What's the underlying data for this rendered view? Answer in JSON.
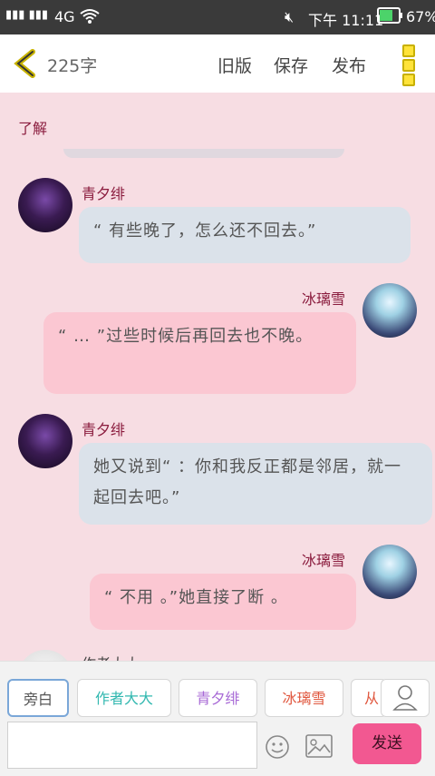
{
  "status": {
    "network": "4G",
    "time": "下午 11:11",
    "battery": "67%"
  },
  "header": {
    "word_count": "225字",
    "old_version": "旧版",
    "save": "保存",
    "publish": "发布"
  },
  "chat": {
    "partial_name": "了解",
    "messages": [
      {
        "name": "青夕绯",
        "text": "“ 有些晚了，怎么还不回去。”",
        "side": "left",
        "avatar": "dark"
      },
      {
        "name": "冰璃雪",
        "text": "“ … ”过些时候后再回去也不晚。",
        "side": "right",
        "avatar": "light"
      },
      {
        "name": "青夕绯",
        "text": "她又说到“ ：你和我反正都是邻居，就一起回去吧。”",
        "side": "left",
        "avatar": "dark"
      },
      {
        "name": "冰璃雪",
        "text": "“ 不用 。”她直接了断 。",
        "side": "right",
        "avatar": "light"
      }
    ],
    "partial_last_name": "作者大大"
  },
  "roles": [
    {
      "label": "旁白",
      "color": "#555555"
    },
    {
      "label": "作者大大",
      "color": "#32b8b0"
    },
    {
      "label": "青夕绯",
      "color": "#a86ad6"
    },
    {
      "label": "冰璃雪",
      "color": "#e0573e"
    },
    {
      "label": "从",
      "color": "#e0573e"
    }
  ],
  "composer": {
    "send_label": "发送"
  },
  "icons": {
    "back": "chevron-left-icon",
    "menu": "more-vertical-icon",
    "emoji": "smiley-icon",
    "image": "image-icon",
    "user": "user-icon"
  }
}
